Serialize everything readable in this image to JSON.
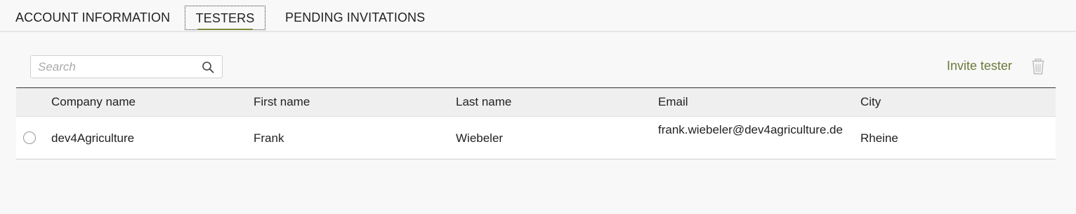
{
  "tabs": [
    {
      "label": "ACCOUNT INFORMATION",
      "active": false
    },
    {
      "label": "TESTERS",
      "active": true
    },
    {
      "label": "PENDING INVITATIONS",
      "active": false
    }
  ],
  "search": {
    "placeholder": "Search",
    "value": "",
    "icon": "search-icon"
  },
  "actions": {
    "invite_label": "Invite tester",
    "delete_icon": "trash-icon"
  },
  "colors": {
    "accent": "#6b7a3a",
    "background": "#f8f8f8"
  },
  "table": {
    "columns": [
      "Company name",
      "First name",
      "Last name",
      "Email",
      "City"
    ],
    "rows": [
      {
        "selected": false,
        "company": "dev4Agriculture",
        "first_name": "Frank",
        "last_name": "Wiebeler",
        "email": "frank.wiebeler@dev4agriculture.de",
        "city": "Rheine"
      }
    ]
  }
}
